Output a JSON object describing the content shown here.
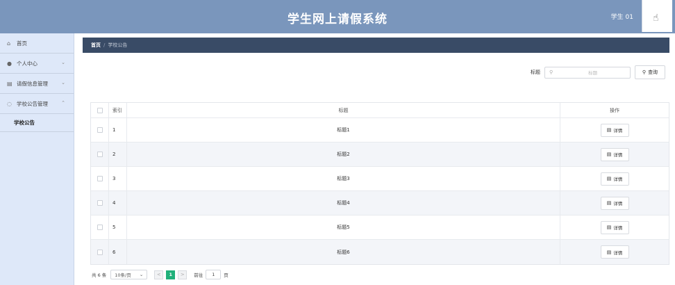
{
  "header": {
    "title": "学生网上请假系统",
    "user": "学生 01"
  },
  "sidebar": {
    "items": [
      {
        "icon": "home-icon",
        "glyph": "⌂",
        "label": "首页"
      },
      {
        "icon": "user-icon",
        "glyph": "●",
        "label": "个人中心",
        "arrow": "⌄"
      },
      {
        "icon": "bank-icon",
        "glyph": "▤",
        "label": "请假信息管理",
        "arrow": "⌄"
      },
      {
        "icon": "globe-icon",
        "glyph": "◌",
        "label": "学校公告管理",
        "arrow": "⌃"
      }
    ],
    "sub_item": "学校公告"
  },
  "breadcrumb": {
    "home": "首页",
    "sep": "/",
    "current": "学校公告"
  },
  "search": {
    "label": "标题",
    "placeholder": "标题",
    "button": "查询"
  },
  "table": {
    "headers": {
      "index": "索引",
      "title": "标题",
      "ops": "操作"
    },
    "rows": [
      {
        "index": "1",
        "title": "标题1"
      },
      {
        "index": "2",
        "title": "标题2"
      },
      {
        "index": "3",
        "title": "标题3"
      },
      {
        "index": "4",
        "title": "标题4"
      },
      {
        "index": "5",
        "title": "标题5"
      },
      {
        "index": "6",
        "title": "标题6"
      }
    ],
    "detail_label": "详情"
  },
  "pagination": {
    "total": "共 6 条",
    "page_size": "10条/页",
    "prev": "<",
    "current_page": "1",
    "next": ">",
    "goto_prefix": "前往",
    "goto_value": "1",
    "goto_suffix": "页"
  },
  "colors": {
    "header": "#7a96bc",
    "sidebar": "#dee8f9",
    "breadcrumb": "#394b66",
    "accent": "#20b07a"
  }
}
